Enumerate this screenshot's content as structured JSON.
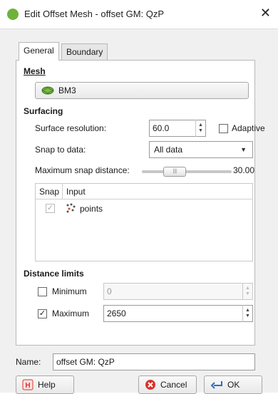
{
  "window": {
    "title": "Edit Offset Mesh - offset GM: QzP",
    "close_glyph": "✕"
  },
  "tabs": [
    {
      "label": "General",
      "active": true
    },
    {
      "label": "Boundary",
      "active": false
    }
  ],
  "mesh": {
    "section": "Mesh",
    "value": "BM3"
  },
  "surfacing": {
    "section": "Surfacing",
    "resolution_label": "Surface resolution:",
    "resolution_value": "60.0",
    "adaptive_label": "Adaptive",
    "snap_label": "Snap to data:",
    "snap_value": "All data",
    "max_snap_label": "Maximum snap distance:",
    "max_snap_value": "30.00",
    "slider_fraction": 0.28,
    "table": {
      "col_snap": "Snap",
      "col_input": "Input",
      "rows": [
        {
          "name": "points",
          "snapped": true
        }
      ]
    }
  },
  "distance_limits": {
    "section": "Distance limits",
    "minimum_label": "Minimum",
    "minimum_value": "0",
    "maximum_label": "Maximum",
    "maximum_value": "2650"
  },
  "name": {
    "label": "Name:",
    "value": "offset GM: QzP"
  },
  "buttons": {
    "help": "Help",
    "cancel": "Cancel",
    "ok": "OK"
  },
  "colors": {
    "accent_green": "#6fb23a",
    "help_red": "#d9342b",
    "cancel_red": "#d9342b",
    "ok_blue": "#2d6fc1"
  }
}
